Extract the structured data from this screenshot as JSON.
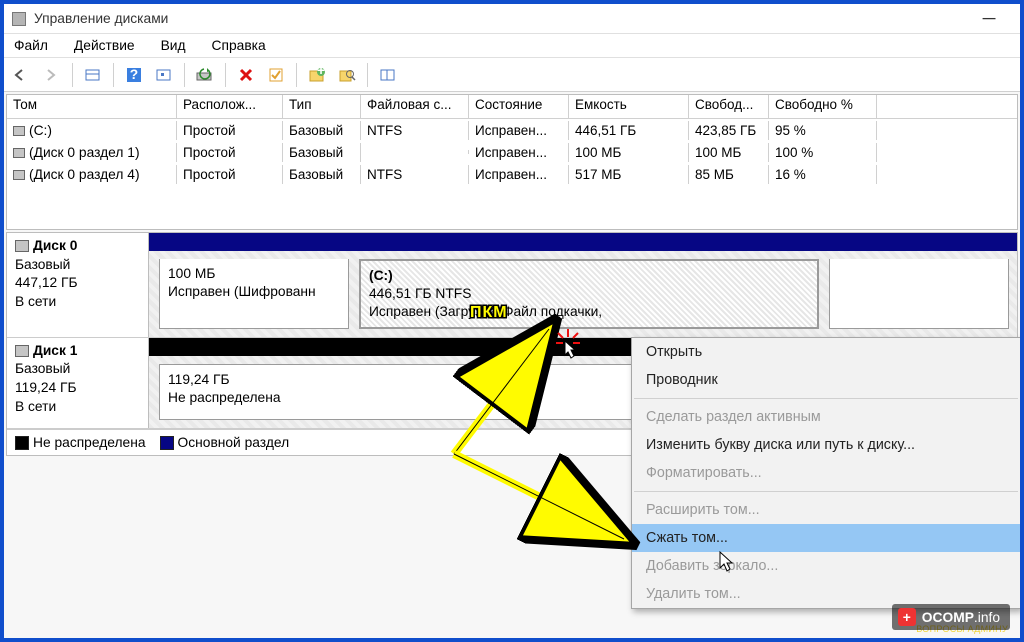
{
  "window": {
    "title": "Управление дисками"
  },
  "menu": {
    "file": "Файл",
    "action": "Действие",
    "view": "Вид",
    "help": "Справка"
  },
  "columns": {
    "volume": "Том",
    "layout": "Располож...",
    "type": "Тип",
    "fs": "Файловая с...",
    "status": "Состояние",
    "capacity": "Емкость",
    "free": "Свобод...",
    "pct": "Свободно %"
  },
  "volumes": [
    {
      "name": "(C:)",
      "layout": "Простой",
      "type": "Базовый",
      "fs": "NTFS",
      "status": "Исправен...",
      "capacity": "446,51 ГБ",
      "free": "423,85 ГБ",
      "pct": "95 %"
    },
    {
      "name": "(Диск 0 раздел 1)",
      "layout": "Простой",
      "type": "Базовый",
      "fs": "",
      "status": "Исправен...",
      "capacity": "100 МБ",
      "free": "100 МБ",
      "pct": "100 %"
    },
    {
      "name": "(Диск 0 раздел 4)",
      "layout": "Простой",
      "type": "Базовый",
      "fs": "NTFS",
      "status": "Исправен...",
      "capacity": "517 МБ",
      "free": "85 МБ",
      "pct": "16 %"
    }
  ],
  "disks": {
    "disk0": {
      "title": "Диск 0",
      "type": "Базовый",
      "size": "447,12 ГБ",
      "status": "В сети",
      "p1": {
        "size": "100 МБ",
        "status": "Исправен (Шифрованн"
      },
      "p2": {
        "label": "(C:)",
        "size_fs": "446,51 ГБ NTFS",
        "status": "Исправен (Загрузка, Файл подкачки,"
      },
      "p3": {
        "size_fs": ""
      }
    },
    "disk1": {
      "title": "Диск 1",
      "type": "Базовый",
      "size": "119,24 ГБ",
      "status": "В сети",
      "p1": {
        "size": "119,24 ГБ",
        "status": "Не распределена"
      }
    }
  },
  "legend": {
    "unallocated": "Не распределена",
    "primary": "Основной раздел"
  },
  "context_menu": {
    "open": "Открыть",
    "explorer": "Проводник",
    "make_active": "Сделать раздел активным",
    "change_letter": "Изменить букву диска или путь к диску...",
    "format": "Форматировать...",
    "extend": "Расширить том...",
    "shrink": "Сжать том...",
    "add_mirror": "Добавить зеркало...",
    "delete": "Удалить том..."
  },
  "annotation": {
    "pkm": "ПКМ"
  },
  "watermark": {
    "brand": "OCOMP",
    "tld": ".info",
    "sub": "ВОПРОСЫ АДМИНУ"
  }
}
